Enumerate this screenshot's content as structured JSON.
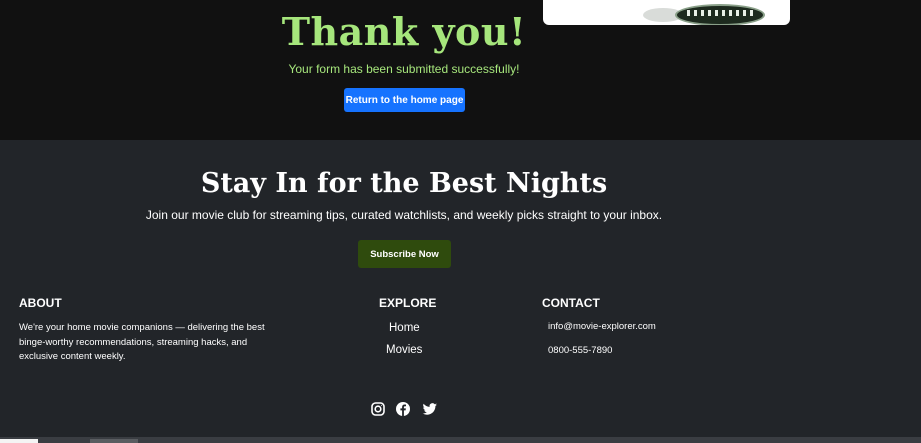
{
  "thanks": {
    "title": "Thank you!",
    "message": "Your form has been submitted successfully!",
    "button_label": "Return to the home page"
  },
  "cta": {
    "title": "Stay In for the Best Nights",
    "subtitle": "Join our movie club for streaming tips, curated watchlists, and weekly picks straight to your inbox.",
    "button_label": "Subscribe Now"
  },
  "footer": {
    "about": {
      "heading": "ABOUT",
      "text": "We're your home movie companions — delivering the best binge-worthy recommendations, streaming hacks, and exclusive content weekly."
    },
    "explore": {
      "heading": "EXPLORE",
      "links": [
        "Home",
        "Movies"
      ]
    },
    "contact": {
      "heading": "CONTACT",
      "email": "info@movie-explorer.com",
      "phone": "0800-555-7890"
    },
    "social": [
      "instagram-icon",
      "facebook-icon",
      "twitter-icon"
    ]
  },
  "colors": {
    "hero_bg": "#111111",
    "footer_bg": "#222529",
    "accent_green": "#a6e67c",
    "primary_button": "#1673ff",
    "subscribe_button": "#2f4b0d"
  }
}
